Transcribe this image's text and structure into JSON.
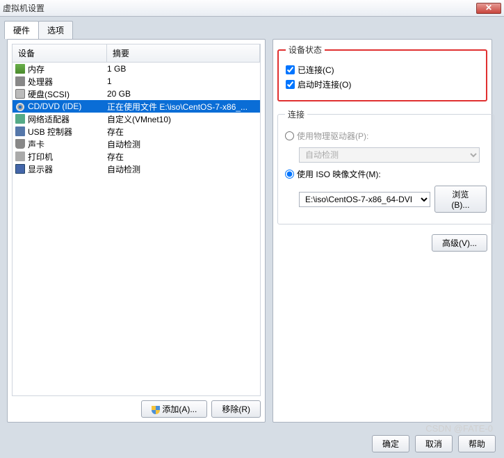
{
  "title": "虚拟机设置",
  "tabs": {
    "hardware": "硬件",
    "options": "选项"
  },
  "columns": {
    "device": "设备",
    "summary": "摘要"
  },
  "devices": [
    {
      "icon": "ico-mem",
      "name": "内存",
      "summary": "1 GB"
    },
    {
      "icon": "ico-cpu",
      "name": "处理器",
      "summary": "1"
    },
    {
      "icon": "ico-hdd",
      "name": "硬盘(SCSI)",
      "summary": "20 GB"
    },
    {
      "icon": "ico-cd",
      "name": "CD/DVD (IDE)",
      "summary": "正在使用文件 E:\\iso\\CentOS-7-x86_..."
    },
    {
      "icon": "ico-net",
      "name": "网络适配器",
      "summary": "自定义(VMnet10)"
    },
    {
      "icon": "ico-usb",
      "name": "USB 控制器",
      "summary": "存在"
    },
    {
      "icon": "ico-snd",
      "name": "声卡",
      "summary": "自动检测"
    },
    {
      "icon": "ico-prn",
      "name": "打印机",
      "summary": "存在"
    },
    {
      "icon": "ico-disp",
      "name": "显示器",
      "summary": "自动检测"
    }
  ],
  "buttons": {
    "add": "添加(A)...",
    "remove": "移除(R)"
  },
  "status": {
    "legend": "设备状态",
    "connected": "已连接(C)",
    "connectAtPowerOn": "启动时连接(O)"
  },
  "connection": {
    "legend": "连接",
    "usePhysical": "使用物理驱动器(P):",
    "autoDetect": "自动检测",
    "useIso": "使用 ISO 映像文件(M):",
    "isoPath": "E:\\iso\\CentOS-7-x86_64-DVI",
    "browse": "浏览(B)..."
  },
  "advanced": "高级(V)...",
  "footer": {
    "ok": "确定",
    "cancel": "取消",
    "help": "帮助"
  },
  "watermark": "CSDN @FATE-0"
}
